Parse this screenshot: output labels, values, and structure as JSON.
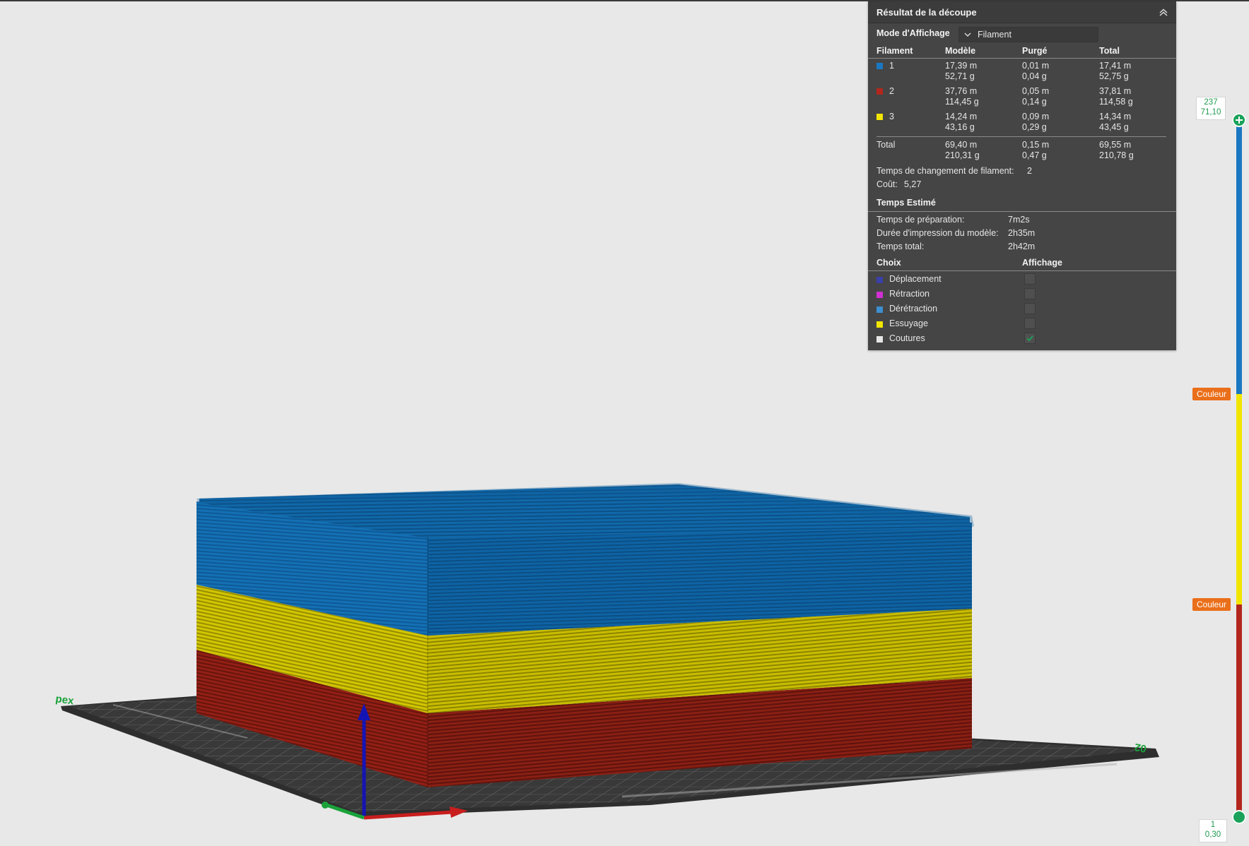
{
  "panel": {
    "title": "Résultat de la découpe",
    "mode_label": "Mode d'Affichage",
    "mode_value": "Filament",
    "headers": {
      "filament": "Filament",
      "model": "Modèle",
      "purged": "Purgé",
      "total": "Total"
    },
    "rows": [
      {
        "id": "1",
        "color": "#1a78c2",
        "model_m": "17,39 m",
        "model_g": "52,71 g",
        "purged_m": "0,01 m",
        "purged_g": "0,04 g",
        "total_m": "17,41 m",
        "total_g": "52,75 g"
      },
      {
        "id": "2",
        "color": "#b3261e",
        "model_m": "37,76 m",
        "model_g": "114,45 g",
        "purged_m": "0,05 m",
        "purged_g": "0,14 g",
        "total_m": "37,81 m",
        "total_g": "114,58 g"
      },
      {
        "id": "3",
        "color": "#f2e500",
        "model_m": "14,24 m",
        "model_g": "43,16 g",
        "purged_m": "0,09 m",
        "purged_g": "0,29 g",
        "total_m": "14,34 m",
        "total_g": "43,45 g"
      }
    ],
    "totals": {
      "label": "Total",
      "model_m": "69,40 m",
      "model_g": "210,31 g",
      "purged_m": "0,15 m",
      "purged_g": "0,47 g",
      "total_m": "69,55 m",
      "total_g": "210,78 g"
    },
    "filament_change_label": "Temps de changement de filament:",
    "filament_change_value": "2",
    "cost_label": "Coût:",
    "cost_value": "5,27",
    "time_section": "Temps Estimé",
    "times": [
      {
        "label": "Temps de préparation:",
        "value": "7m2s"
      },
      {
        "label": "Durée d'impression du modèle:",
        "value": "2h35m"
      },
      {
        "label": "Temps total:",
        "value": "2h42m"
      }
    ],
    "choice_header": "Choix",
    "display_header": "Affichage",
    "options": [
      {
        "label": "Déplacement",
        "color": "#3b3fa8",
        "checked": false
      },
      {
        "label": "Rétraction",
        "color": "#d12fd4",
        "checked": false
      },
      {
        "label": "Dérétraction",
        "color": "#3d8fd0",
        "checked": false
      },
      {
        "label": "Essuyage",
        "color": "#f2e500",
        "checked": false
      },
      {
        "label": "Coutures",
        "color": "#e6e6e6",
        "checked": true
      }
    ]
  },
  "slider": {
    "top_layer": "237",
    "top_height": "71,10",
    "bottom_layer": "1",
    "bottom_height": "0,30",
    "color_change_label_1": "Couleur",
    "color_change_label_2": "Couleur",
    "colors": {
      "top": "#1a78c2",
      "middle": "#f2e500",
      "bottom": "#b3261e",
      "handle": "#1aa25a"
    }
  },
  "scene": {
    "bed_label_left": "pex",
    "bed_label_right": "02",
    "axis_colors": {
      "x": "#c81e1e",
      "y": "#1aa23a",
      "z": "#1414b4"
    }
  }
}
